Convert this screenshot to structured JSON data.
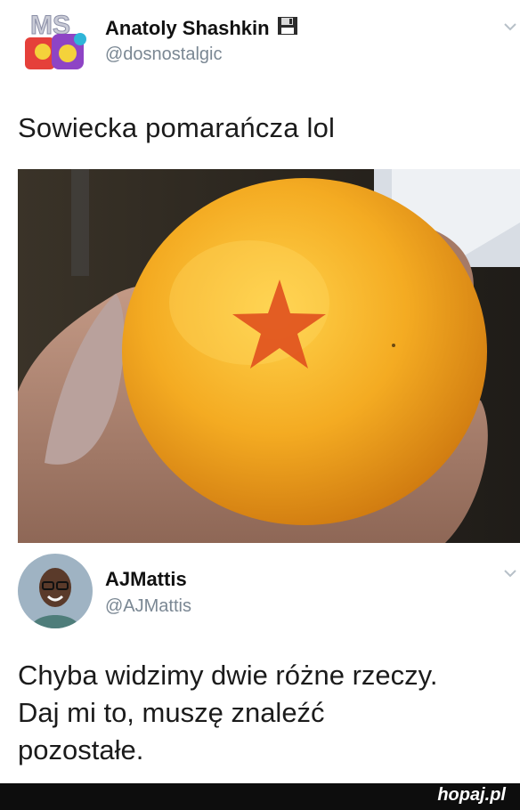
{
  "tweet": {
    "author_name": "Anatoly Shashkin",
    "author_handle": "@dosnostalgic",
    "author_badge_icon": "floppy-disk-icon",
    "text": "Sowiecka pomarańcza lol"
  },
  "reply": {
    "author_name": "AJMattis",
    "author_handle": "@AJMattis",
    "text_lines": [
      "Chyba widzimy dwie różne rzeczy.",
      "Daj mi to, muszę znaleźć",
      "pozostałe."
    ]
  },
  "footer": {
    "watermark": "hopaj.pl"
  },
  "colors": {
    "handle": "#7a8793",
    "orange": "#f2a21f",
    "star": "#e0501e",
    "footer_bg": "#0d0d0d"
  }
}
